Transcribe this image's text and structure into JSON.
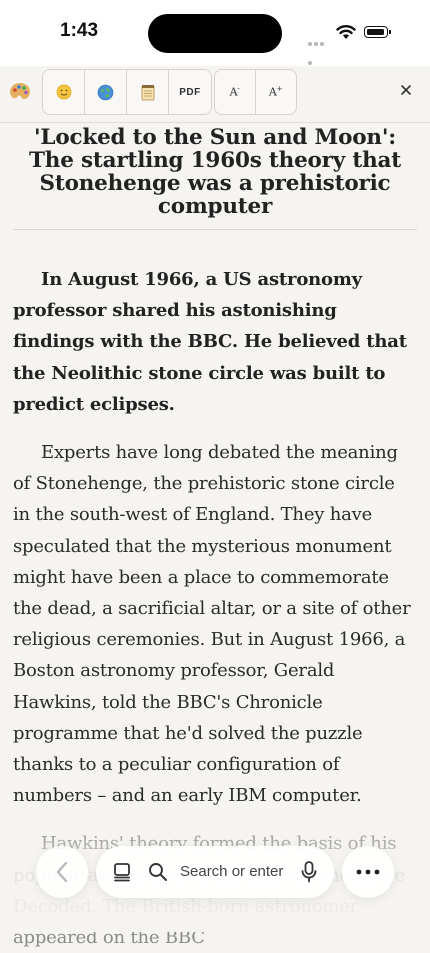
{
  "status_bar": {
    "time": "1:43"
  },
  "toolbar": {
    "pdf_label": "PDF",
    "font_decrease_label": "A",
    "font_decrease_sup": "-",
    "font_increase_label": "A",
    "font_increase_sup": "+",
    "icons": [
      "palette-icon",
      "emoji-icon",
      "globe-icon",
      "notepad-icon",
      "close-icon"
    ]
  },
  "article": {
    "title": "'Locked to the Sun and Moon': The startling 1960s theory that Stonehenge was a prehistoric computer",
    "lead": "In August 1966, a US astronomy professor shared his astonishing findings with the BBC. He believed that the Neolithic stone circle was built to predict eclipses.",
    "paragraphs": [
      "Experts have long debated the meaning of Stonehenge, the prehistoric stone circle in the south-west of England. They have speculated that the mysterious monument might have been a place to commemorate the dead, a sacrificial altar, or a site of other religious ceremonies. But in August 1966, a Boston astronomy professor, Gerald Hawkins, told the BBC's Chronicle programme that he'd solved the puzzle thanks to a peculiar configuration of numbers – and an early IBM computer.",
      "Hawkins' theory formed the basis of his popular and controversial book Stonehenge Decoded. The British-born astronomer appeared on the BBC"
    ]
  },
  "bottom_bar": {
    "search_placeholder": "Search or enter"
  }
}
